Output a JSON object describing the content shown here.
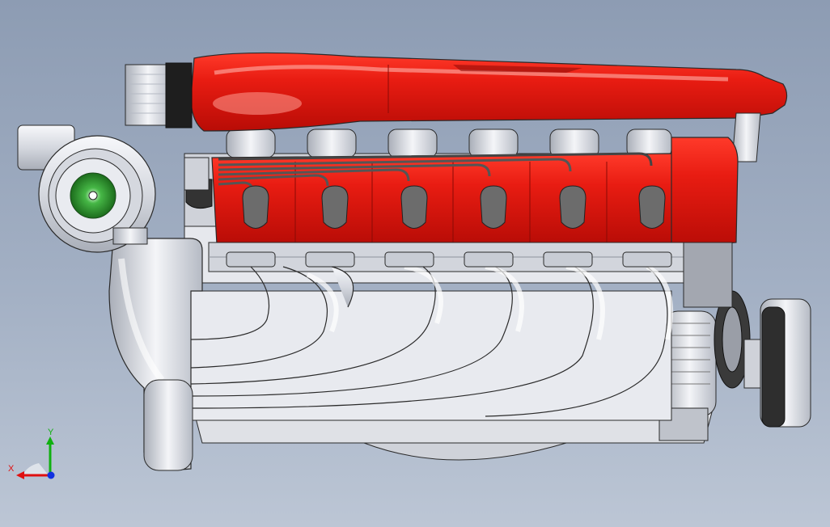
{
  "viewport": {
    "background_top": "#8d9cb3",
    "background_bottom": "#bcc6d5"
  },
  "model": {
    "colors": {
      "intake_red": "#e21b12",
      "intake_highlight": "#ff8c80",
      "chrome": "#e4e6ec",
      "chrome_shadow": "#9aa0ab",
      "outline": "#2a2a2a",
      "coil_gray": "#6c6c6c",
      "turbine_green": "#2f9a2f",
      "pulley_dark": "#2e2e2e"
    },
    "ignition_coil_count": 6,
    "exhaust_runner_count": 6
  },
  "triad": {
    "x_label": "X",
    "y_label": "Y",
    "x_color": "#e01010",
    "y_color": "#10b010",
    "z_color": "#1030e0"
  }
}
